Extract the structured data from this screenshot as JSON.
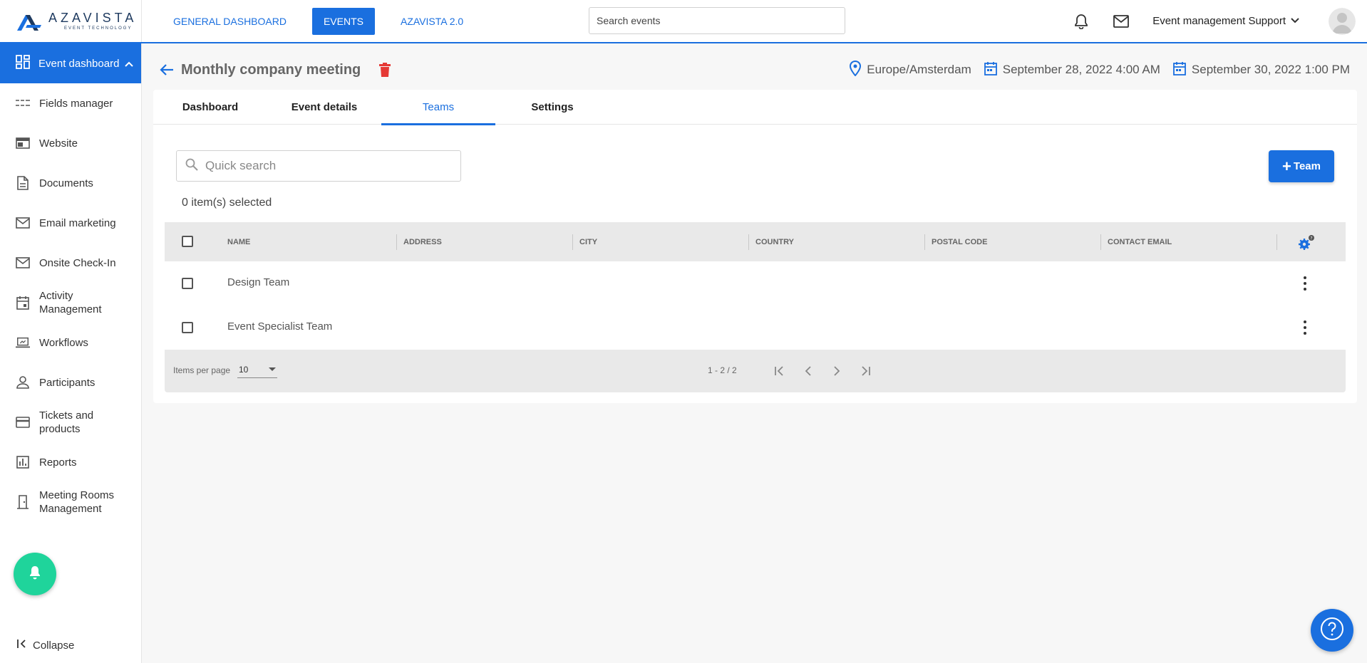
{
  "brand": {
    "name": "AZAVISTA",
    "tagline": "EVENT TECHNOLOGY",
    "color": "#1a6fdf",
    "accent": "#1fd49b"
  },
  "topnav": {
    "items": [
      {
        "label": "GENERAL DASHBOARD",
        "active": false
      },
      {
        "label": "EVENTS",
        "active": true
      },
      {
        "label": "AZAVISTA 2.0",
        "active": false
      }
    ],
    "search_placeholder": "Search events",
    "bell_icon": "bell-icon",
    "mail_icon": "mail-icon",
    "user_name": "Event management Support"
  },
  "sidebar": {
    "active": {
      "label": "Event dashboard",
      "icon": "dashboard-icon"
    },
    "items": [
      {
        "label": "Fields manager",
        "icon": "fields-icon"
      },
      {
        "label": "Website",
        "icon": "website-icon"
      },
      {
        "label": "Documents",
        "icon": "document-icon"
      },
      {
        "label": "Email marketing",
        "icon": "mail-icon"
      },
      {
        "label": "Onsite Check-In",
        "icon": "mail-icon"
      },
      {
        "label": "Activity Management",
        "icon": "calendar-icon"
      },
      {
        "label": "Workflows",
        "icon": "laptop-icon"
      },
      {
        "label": "Participants",
        "icon": "person-icon"
      },
      {
        "label": "Tickets and products",
        "icon": "card-icon"
      },
      {
        "label": "Reports",
        "icon": "chart-icon"
      },
      {
        "label": "Meeting Rooms Management",
        "icon": "door-icon"
      }
    ],
    "collapse_label": "Collapse"
  },
  "header": {
    "title": "Monthly company meeting",
    "timezone": "Europe/Amsterdam",
    "start": "September 28, 2022 4:00 AM",
    "end": "September 30, 2022 1:00 PM"
  },
  "tabs": [
    {
      "label": "Dashboard",
      "active": false
    },
    {
      "label": "Event details",
      "active": false
    },
    {
      "label": "Teams",
      "active": true
    },
    {
      "label": "Settings",
      "active": false
    }
  ],
  "teams": {
    "search_placeholder": "Quick search",
    "add_label": "Team",
    "selected_text": "0 item(s) selected",
    "columns": [
      "NAME",
      "ADDRESS",
      "CITY",
      "COUNTRY",
      "POSTAL CODE",
      "CONTACT EMAIL"
    ],
    "rows": [
      {
        "name": "Design Team"
      },
      {
        "name": "Event Specialist Team"
      }
    ],
    "footer": {
      "items_per_page_label": "Items per page",
      "items_per_page": "10",
      "range": "1 - 2 / 2"
    }
  }
}
